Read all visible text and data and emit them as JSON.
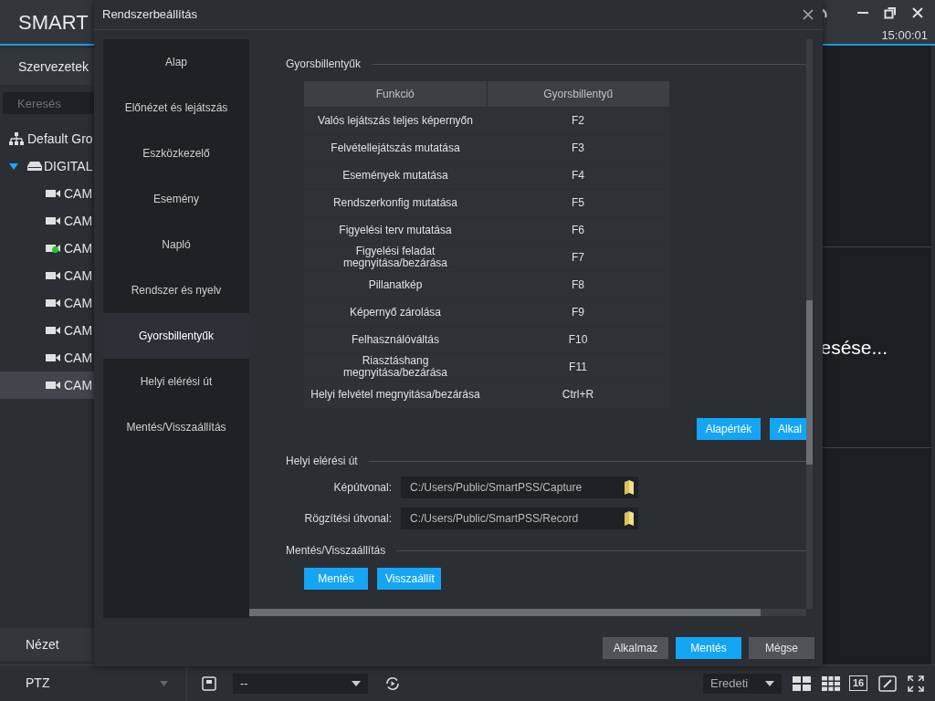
{
  "app": {
    "logo": "SMART",
    "time": "15:00:01",
    "sidebar": {
      "tab": "Szervezetek",
      "search_placeholder": "Keresés",
      "tree": [
        {
          "kind": "group",
          "label": "Default Gro"
        },
        {
          "kind": "device",
          "label": "DIGITAL",
          "expanded": true,
          "children": [
            {
              "label": "CAM",
              "online": false,
              "selected": false
            },
            {
              "label": "CAM",
              "online": false,
              "selected": false
            },
            {
              "label": "CAM",
              "online": true,
              "selected": false
            },
            {
              "label": "CAM",
              "online": false,
              "selected": false
            },
            {
              "label": "CAM",
              "online": false,
              "selected": false
            },
            {
              "label": "CAM",
              "online": false,
              "selected": false
            },
            {
              "label": "CAM",
              "online": false,
              "selected": false
            },
            {
              "label": "CAM",
              "online": false,
              "selected": true
            }
          ]
        }
      ],
      "bottom_panels": [
        "Nézet",
        "PTZ"
      ]
    },
    "video_message": "esése...",
    "toolbar": {
      "preset": "--",
      "view": "Eredeti",
      "layout_16": "16"
    }
  },
  "dialog": {
    "title": "Rendszerbeállítás",
    "nav": [
      {
        "label": "Alap",
        "selected": false
      },
      {
        "label": "Előnézet és lejátszás",
        "selected": false
      },
      {
        "label": "Eszközkezelő",
        "selected": false
      },
      {
        "label": "Esemény",
        "selected": false
      },
      {
        "label": "Napló",
        "selected": false
      },
      {
        "label": "Rendszer és nyelv",
        "selected": false
      },
      {
        "label": "Gyorsbillentyűk",
        "selected": true
      },
      {
        "label": "Helyi elérési út",
        "selected": false
      },
      {
        "label": "Mentés/Visszaállítás",
        "selected": false
      }
    ],
    "hotkeys": {
      "title": "Gyorsbillentyűk",
      "columns": [
        "Funkció",
        "Gyorsbillentyű"
      ],
      "rows": [
        [
          "Valós lejátszás teljes képernyőn",
          "F2"
        ],
        [
          "Felvétellejátszás mutatása",
          "F3"
        ],
        [
          "Események mutatása",
          "F4"
        ],
        [
          "Rendszerkonfig mutatása",
          "F5"
        ],
        [
          "Figyelési terv mutatása",
          "F6"
        ],
        [
          "Figyelési feladat megnyitása/bezárása",
          "F7"
        ],
        [
          "Pillanatkép",
          "F8"
        ],
        [
          "Képernyő zárolása",
          "F9"
        ],
        [
          "Felhasználóváltás",
          "F10"
        ],
        [
          "Riasztáshang megnyitása/bezárása",
          "F11"
        ],
        [
          "Helyi felvétel megnyitása/bezárása",
          "Ctrl+R"
        ]
      ],
      "buttons": [
        "Alapérték",
        "Alkal"
      ]
    },
    "local_path": {
      "title": "Helyi elérési út",
      "fields": [
        {
          "label": "Képútvonal:",
          "value": "C:/Users/Public/SmartPSS/Capture"
        },
        {
          "label": "Rögzítési útvonal:",
          "value": "C:/Users/Public/SmartPSS/Record"
        }
      ]
    },
    "backup": {
      "title": "Mentés/Visszaállítás",
      "buttons": [
        "Mentés",
        "Visszaállít"
      ]
    },
    "footer_buttons": [
      {
        "label": "Alkalmaz",
        "primary": false
      },
      {
        "label": "Mentés",
        "primary": true
      },
      {
        "label": "Mégse",
        "primary": false
      }
    ]
  }
}
